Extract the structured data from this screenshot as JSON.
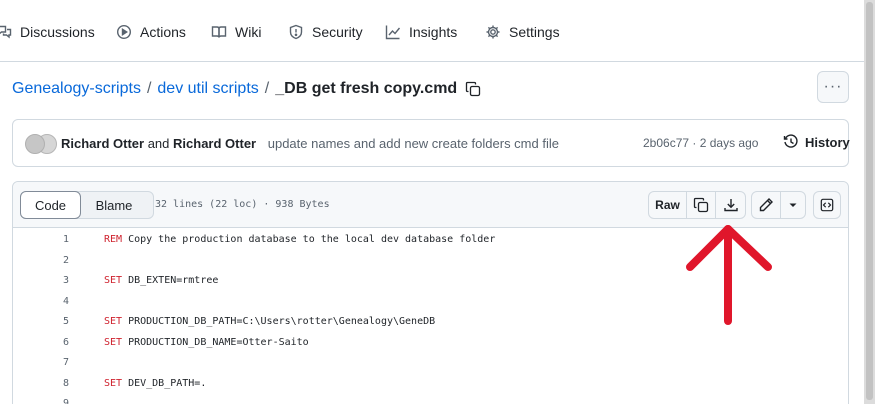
{
  "nav": {
    "items": [
      {
        "label": "Discussions",
        "icon": "comment-discussion-icon"
      },
      {
        "label": "Actions",
        "icon": "play-icon"
      },
      {
        "label": "Wiki",
        "icon": "book-icon"
      },
      {
        "label": "Security",
        "icon": "shield-icon"
      },
      {
        "label": "Insights",
        "icon": "graph-icon"
      },
      {
        "label": "Settings",
        "icon": "gear-icon"
      }
    ]
  },
  "breadcrumb": {
    "repo": "Genealogy-scripts",
    "folder": "dev util scripts",
    "separator": "/",
    "file": "_DB get fresh copy.cmd",
    "more_label": "···"
  },
  "commit": {
    "author1": "Richard Otter",
    "joiner": "and",
    "author2": "Richard Otter",
    "message": "update names and add new create folders cmd file",
    "meta": "2b06c77 · 2 days ago",
    "history_label": "History"
  },
  "file_header": {
    "code_label": "Code",
    "blame_label": "Blame",
    "info": "32 lines (22 loc) · 938 Bytes",
    "raw_label": "Raw"
  },
  "code_lines": [
    {
      "n": "1",
      "kw": "REM",
      "rest": " Copy the production database to the local dev database folder"
    },
    {
      "n": "2",
      "kw": "",
      "rest": ""
    },
    {
      "n": "3",
      "kw": "SET",
      "rest": " DB_EXTEN=rmtree"
    },
    {
      "n": "4",
      "kw": "",
      "rest": ""
    },
    {
      "n": "5",
      "kw": "SET",
      "rest": " PRODUCTION_DB_PATH=C:\\Users\\rotter\\Genealogy\\GeneDB"
    },
    {
      "n": "6",
      "kw": "SET",
      "rest": " PRODUCTION_DB_NAME=Otter-Saito"
    },
    {
      "n": "7",
      "kw": "",
      "rest": ""
    },
    {
      "n": "8",
      "kw": "SET",
      "rest": " DEV_DB_PATH=."
    },
    {
      "n": "9",
      "kw": "",
      "rest": ""
    }
  ],
  "colors": {
    "link": "#0969da",
    "keyword": "#cf222e",
    "annotation_arrow": "#e0162b"
  }
}
